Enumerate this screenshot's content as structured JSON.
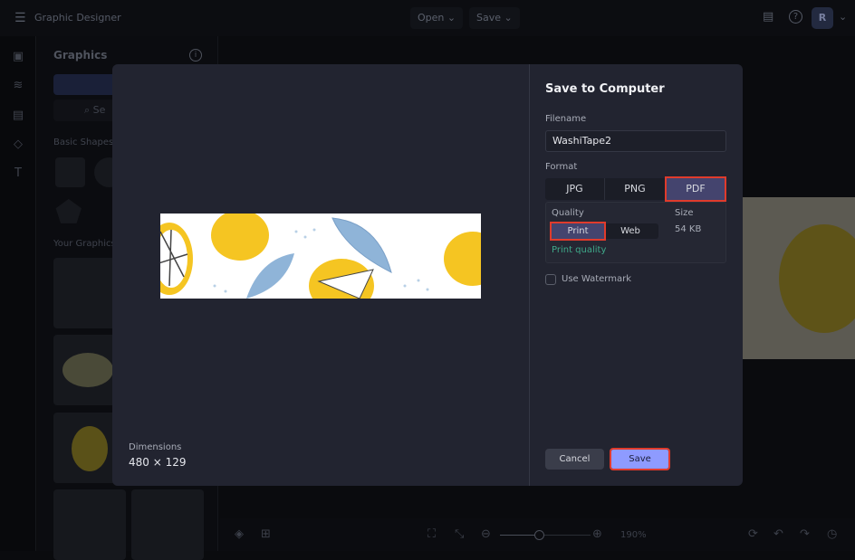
{
  "topbar": {
    "app_title": "Graphic Designer",
    "open_label": "Open",
    "save_label": "Save",
    "avatar_initial": "R"
  },
  "panel": {
    "title": "Graphics",
    "search_placeholder": "Se",
    "basic_shapes": "Basic Shapes",
    "your_graphics": "Your Graphics"
  },
  "bottombar": {
    "zoom": "190%"
  },
  "modal": {
    "title": "Save to Computer",
    "filename_label": "Filename",
    "filename_value": "WashiTape2",
    "format_label": "Format",
    "formats": [
      "JPG",
      "PNG",
      "PDF"
    ],
    "selected_format": "PDF",
    "quality_label": "Quality",
    "qualities": [
      "Print",
      "Web"
    ],
    "selected_quality": "Print",
    "quality_hint": "Print quality",
    "size_label": "Size",
    "size_value": "54 KB",
    "watermark_label": "Use Watermark",
    "watermark_checked": false,
    "dimensions_label": "Dimensions",
    "dimensions_value": "480 × 129",
    "cancel_label": "Cancel",
    "save_label": "Save"
  },
  "colors": {
    "accent": "#8e9bff",
    "selected_seg": "#44446e",
    "hint": "#3fa98a",
    "highlight": "#e03b2c"
  }
}
